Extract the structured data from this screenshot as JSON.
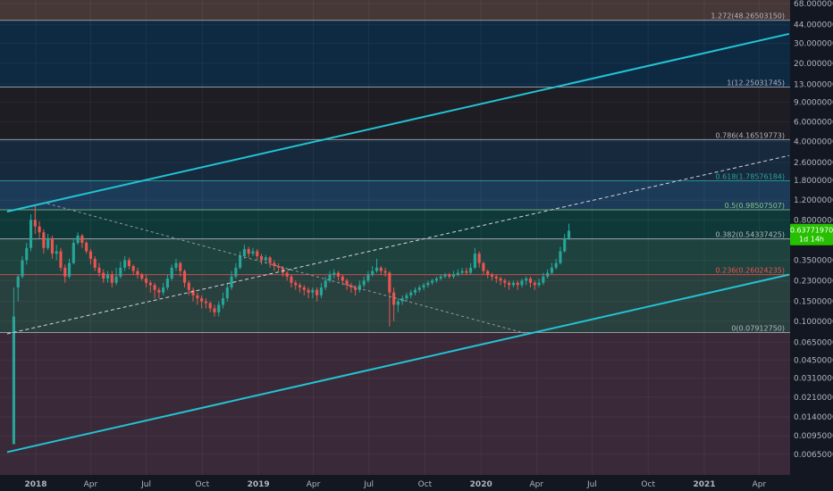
{
  "chart_data": {
    "type": "candlestick",
    "title": "",
    "scale": "log",
    "ylim": [
      0.0055,
      68.0
    ],
    "y_ticks": [
      "68.00000000",
      "44.00000000",
      "30.00000000",
      "20.00000000",
      "13.00000000",
      "9.00000000",
      "6.00000000",
      "4.00000000",
      "2.60000000",
      "1.80000000",
      "1.20000000",
      "0.80000000",
      "0.53000000",
      "0.35000000",
      "0.23000000",
      "0.15000000",
      "0.10000000",
      "0.06500000",
      "0.04500000",
      "0.03100000",
      "0.02100000",
      "0.01400000",
      "0.00950000",
      "0.00650000"
    ],
    "x_ticks": [
      {
        "label": "2018",
        "date": "2018-01-01",
        "bold": true
      },
      {
        "label": "Apr",
        "date": "2018-04-01",
        "bold": false
      },
      {
        "label": "Jul",
        "date": "2018-07-01",
        "bold": false
      },
      {
        "label": "Oct",
        "date": "2018-10-01",
        "bold": false
      },
      {
        "label": "2019",
        "date": "2019-01-01",
        "bold": true
      },
      {
        "label": "Apr",
        "date": "2019-04-01",
        "bold": false
      },
      {
        "label": "Jul",
        "date": "2019-07-01",
        "bold": false
      },
      {
        "label": "Oct",
        "date": "2019-10-01",
        "bold": false
      },
      {
        "label": "2020",
        "date": "2020-01-01",
        "bold": true
      },
      {
        "label": "Apr",
        "date": "2020-04-01",
        "bold": false
      },
      {
        "label": "Jul",
        "date": "2020-07-01",
        "bold": false
      },
      {
        "label": "Oct",
        "date": "2020-10-01",
        "bold": false
      },
      {
        "label": "2021",
        "date": "2021-01-01",
        "bold": true
      },
      {
        "label": "Apr",
        "date": "2021-04-01",
        "bold": false
      }
    ],
    "fib_levels": [
      {
        "label": "1.272(48.26503150)",
        "value": 48.2650315,
        "color": "#b2b5be"
      },
      {
        "label": "1(12.25031745)",
        "value": 12.25031745,
        "color": "#b2b5be"
      },
      {
        "label": "0.786(4.16519773)",
        "value": 4.16519773,
        "color": "#b2b5be"
      },
      {
        "label": "0.618(1.78576184)",
        "value": 1.78576184,
        "color": "#26a69a"
      },
      {
        "label": "0.5(0.98507507)",
        "value": 0.98507507,
        "color": "#81c784"
      },
      {
        "label": "0.382(0.54337425)",
        "value": 0.54337425,
        "color": "#b2b5be"
      },
      {
        "label": "0.236(0.26024235)",
        "value": 0.26024235,
        "color": "#ef5350"
      },
      {
        "label": "0(0.07912750)",
        "value": 0.0791275,
        "color": "#b2b5be"
      }
    ],
    "price_badge": {
      "price": "0.63771970",
      "countdown": "1d 14h",
      "color": "#26c000"
    },
    "channel_upper": [
      {
        "date": "2017-11-15",
        "price": 0.95
      },
      {
        "date": "2021-05-20",
        "price": 36.5
      }
    ],
    "channel_lower": [
      {
        "date": "2017-11-15",
        "price": 0.0068
      },
      {
        "date": "2021-05-20",
        "price": 0.26
      }
    ],
    "channel_mid": [
      {
        "date": "2017-11-15",
        "price": 0.077
      },
      {
        "date": "2021-05-20",
        "price": 3.0
      }
    ],
    "diag_line": [
      {
        "date": "2018-01-20",
        "price": 1.12
      },
      {
        "date": "2020-03-13",
        "price": 0.078
      }
    ],
    "colors": {
      "up": "#26a69a",
      "down": "#ef5350",
      "channel": "#22c4d4",
      "background": "#131722"
    },
    "ohlc_weekly": [
      [
        0.008,
        0.11,
        0.008,
        0.2
      ],
      [
        0.2,
        0.25,
        0.15,
        0.26
      ],
      [
        0.25,
        0.35,
        0.24,
        0.38
      ],
      [
        0.35,
        0.45,
        0.32,
        0.5
      ],
      [
        0.45,
        0.8,
        0.42,
        0.9
      ],
      [
        0.8,
        0.7,
        0.6,
        1.1
      ],
      [
        0.7,
        0.62,
        0.55,
        0.78
      ],
      [
        0.62,
        0.45,
        0.4,
        0.66
      ],
      [
        0.45,
        0.55,
        0.43,
        0.6
      ],
      [
        0.55,
        0.4,
        0.36,
        0.58
      ],
      [
        0.4,
        0.42,
        0.35,
        0.48
      ],
      [
        0.42,
        0.3,
        0.28,
        0.45
      ],
      [
        0.3,
        0.25,
        0.22,
        0.32
      ],
      [
        0.25,
        0.33,
        0.24,
        0.36
      ],
      [
        0.33,
        0.5,
        0.32,
        0.55
      ],
      [
        0.5,
        0.58,
        0.48,
        0.62
      ],
      [
        0.58,
        0.5,
        0.45,
        0.6
      ],
      [
        0.5,
        0.42,
        0.4,
        0.52
      ],
      [
        0.42,
        0.36,
        0.32,
        0.44
      ],
      [
        0.36,
        0.3,
        0.28,
        0.38
      ],
      [
        0.3,
        0.27,
        0.25,
        0.33
      ],
      [
        0.27,
        0.24,
        0.22,
        0.29
      ],
      [
        0.24,
        0.26,
        0.22,
        0.28
      ],
      [
        0.26,
        0.22,
        0.2,
        0.28
      ],
      [
        0.22,
        0.25,
        0.21,
        0.3
      ],
      [
        0.25,
        0.3,
        0.24,
        0.34
      ],
      [
        0.3,
        0.35,
        0.28,
        0.38
      ],
      [
        0.35,
        0.31,
        0.29,
        0.37
      ],
      [
        0.31,
        0.28,
        0.26,
        0.32
      ],
      [
        0.28,
        0.26,
        0.24,
        0.3
      ],
      [
        0.26,
        0.24,
        0.23,
        0.27
      ],
      [
        0.24,
        0.22,
        0.2,
        0.26
      ],
      [
        0.22,
        0.21,
        0.18,
        0.23
      ],
      [
        0.21,
        0.19,
        0.16,
        0.22
      ],
      [
        0.19,
        0.18,
        0.16,
        0.2
      ],
      [
        0.18,
        0.2,
        0.17,
        0.22
      ],
      [
        0.2,
        0.24,
        0.19,
        0.26
      ],
      [
        0.24,
        0.3,
        0.23,
        0.32
      ],
      [
        0.3,
        0.33,
        0.28,
        0.36
      ],
      [
        0.33,
        0.28,
        0.25,
        0.34
      ],
      [
        0.28,
        0.22,
        0.2,
        0.29
      ],
      [
        0.22,
        0.19,
        0.17,
        0.23
      ],
      [
        0.19,
        0.17,
        0.15,
        0.2
      ],
      [
        0.17,
        0.16,
        0.14,
        0.18
      ],
      [
        0.16,
        0.15,
        0.13,
        0.17
      ],
      [
        0.15,
        0.145,
        0.13,
        0.16
      ],
      [
        0.145,
        0.13,
        0.12,
        0.15
      ],
      [
        0.13,
        0.12,
        0.11,
        0.14
      ],
      [
        0.12,
        0.14,
        0.11,
        0.15
      ],
      [
        0.14,
        0.16,
        0.13,
        0.18
      ],
      [
        0.16,
        0.2,
        0.15,
        0.22
      ],
      [
        0.2,
        0.25,
        0.19,
        0.28
      ],
      [
        0.25,
        0.3,
        0.24,
        0.33
      ],
      [
        0.3,
        0.38,
        0.29,
        0.42
      ],
      [
        0.38,
        0.44,
        0.36,
        0.48
      ],
      [
        0.44,
        0.4,
        0.37,
        0.46
      ],
      [
        0.4,
        0.42,
        0.38,
        0.45
      ],
      [
        0.42,
        0.38,
        0.35,
        0.44
      ],
      [
        0.38,
        0.35,
        0.32,
        0.4
      ],
      [
        0.35,
        0.37,
        0.33,
        0.39
      ],
      [
        0.37,
        0.33,
        0.3,
        0.38
      ],
      [
        0.33,
        0.31,
        0.28,
        0.35
      ],
      [
        0.31,
        0.3,
        0.28,
        0.33
      ],
      [
        0.3,
        0.27,
        0.25,
        0.31
      ],
      [
        0.27,
        0.25,
        0.23,
        0.28
      ],
      [
        0.25,
        0.22,
        0.2,
        0.26
      ],
      [
        0.22,
        0.21,
        0.19,
        0.23
      ],
      [
        0.21,
        0.2,
        0.18,
        0.22
      ],
      [
        0.2,
        0.19,
        0.17,
        0.21
      ],
      [
        0.19,
        0.18,
        0.16,
        0.2
      ],
      [
        0.18,
        0.19,
        0.16,
        0.2
      ],
      [
        0.19,
        0.17,
        0.15,
        0.2
      ],
      [
        0.17,
        0.2,
        0.16,
        0.22
      ],
      [
        0.2,
        0.23,
        0.19,
        0.25
      ],
      [
        0.23,
        0.26,
        0.22,
        0.28
      ],
      [
        0.26,
        0.27,
        0.24,
        0.29
      ],
      [
        0.27,
        0.25,
        0.23,
        0.28
      ],
      [
        0.25,
        0.23,
        0.21,
        0.26
      ],
      [
        0.23,
        0.21,
        0.19,
        0.24
      ],
      [
        0.21,
        0.2,
        0.18,
        0.22
      ],
      [
        0.2,
        0.19,
        0.17,
        0.21
      ],
      [
        0.19,
        0.21,
        0.18,
        0.23
      ],
      [
        0.21,
        0.23,
        0.2,
        0.25
      ],
      [
        0.23,
        0.26,
        0.22,
        0.28
      ],
      [
        0.26,
        0.28,
        0.25,
        0.31
      ],
      [
        0.28,
        0.3,
        0.27,
        0.36
      ],
      [
        0.3,
        0.28,
        0.26,
        0.31
      ],
      [
        0.28,
        0.27,
        0.25,
        0.3
      ],
      [
        0.27,
        0.18,
        0.09,
        0.28
      ],
      [
        0.18,
        0.14,
        0.1,
        0.2
      ],
      [
        0.14,
        0.15,
        0.12,
        0.16
      ],
      [
        0.15,
        0.16,
        0.14,
        0.17
      ],
      [
        0.16,
        0.17,
        0.15,
        0.18
      ],
      [
        0.17,
        0.18,
        0.16,
        0.19
      ],
      [
        0.18,
        0.19,
        0.17,
        0.2
      ],
      [
        0.19,
        0.2,
        0.18,
        0.21
      ],
      [
        0.2,
        0.21,
        0.19,
        0.22
      ],
      [
        0.21,
        0.22,
        0.2,
        0.23
      ],
      [
        0.22,
        0.23,
        0.21,
        0.24
      ],
      [
        0.23,
        0.24,
        0.22,
        0.25
      ],
      [
        0.24,
        0.25,
        0.23,
        0.26
      ],
      [
        0.25,
        0.26,
        0.24,
        0.27
      ],
      [
        0.26,
        0.25,
        0.24,
        0.27
      ],
      [
        0.25,
        0.26,
        0.24,
        0.28
      ],
      [
        0.26,
        0.27,
        0.25,
        0.29
      ],
      [
        0.27,
        0.28,
        0.26,
        0.3
      ],
      [
        0.28,
        0.27,
        0.26,
        0.3
      ],
      [
        0.27,
        0.3,
        0.26,
        0.33
      ],
      [
        0.3,
        0.4,
        0.29,
        0.45
      ],
      [
        0.4,
        0.33,
        0.3,
        0.42
      ],
      [
        0.33,
        0.28,
        0.26,
        0.34
      ],
      [
        0.28,
        0.26,
        0.24,
        0.29
      ],
      [
        0.26,
        0.25,
        0.23,
        0.27
      ],
      [
        0.25,
        0.24,
        0.22,
        0.26
      ],
      [
        0.24,
        0.23,
        0.21,
        0.25
      ],
      [
        0.23,
        0.22,
        0.2,
        0.24
      ],
      [
        0.22,
        0.21,
        0.19,
        0.23
      ],
      [
        0.21,
        0.22,
        0.2,
        0.23
      ],
      [
        0.22,
        0.21,
        0.19,
        0.23
      ],
      [
        0.21,
        0.23,
        0.2,
        0.24
      ],
      [
        0.23,
        0.24,
        0.21,
        0.25
      ],
      [
        0.24,
        0.22,
        0.2,
        0.25
      ],
      [
        0.22,
        0.21,
        0.19,
        0.23
      ],
      [
        0.21,
        0.22,
        0.2,
        0.24
      ],
      [
        0.22,
        0.25,
        0.21,
        0.27
      ],
      [
        0.25,
        0.27,
        0.24,
        0.29
      ],
      [
        0.27,
        0.3,
        0.26,
        0.33
      ],
      [
        0.3,
        0.33,
        0.29,
        0.36
      ],
      [
        0.33,
        0.42,
        0.32,
        0.46
      ],
      [
        0.42,
        0.55,
        0.41,
        0.6
      ],
      [
        0.55,
        0.64,
        0.53,
        0.74
      ]
    ]
  }
}
